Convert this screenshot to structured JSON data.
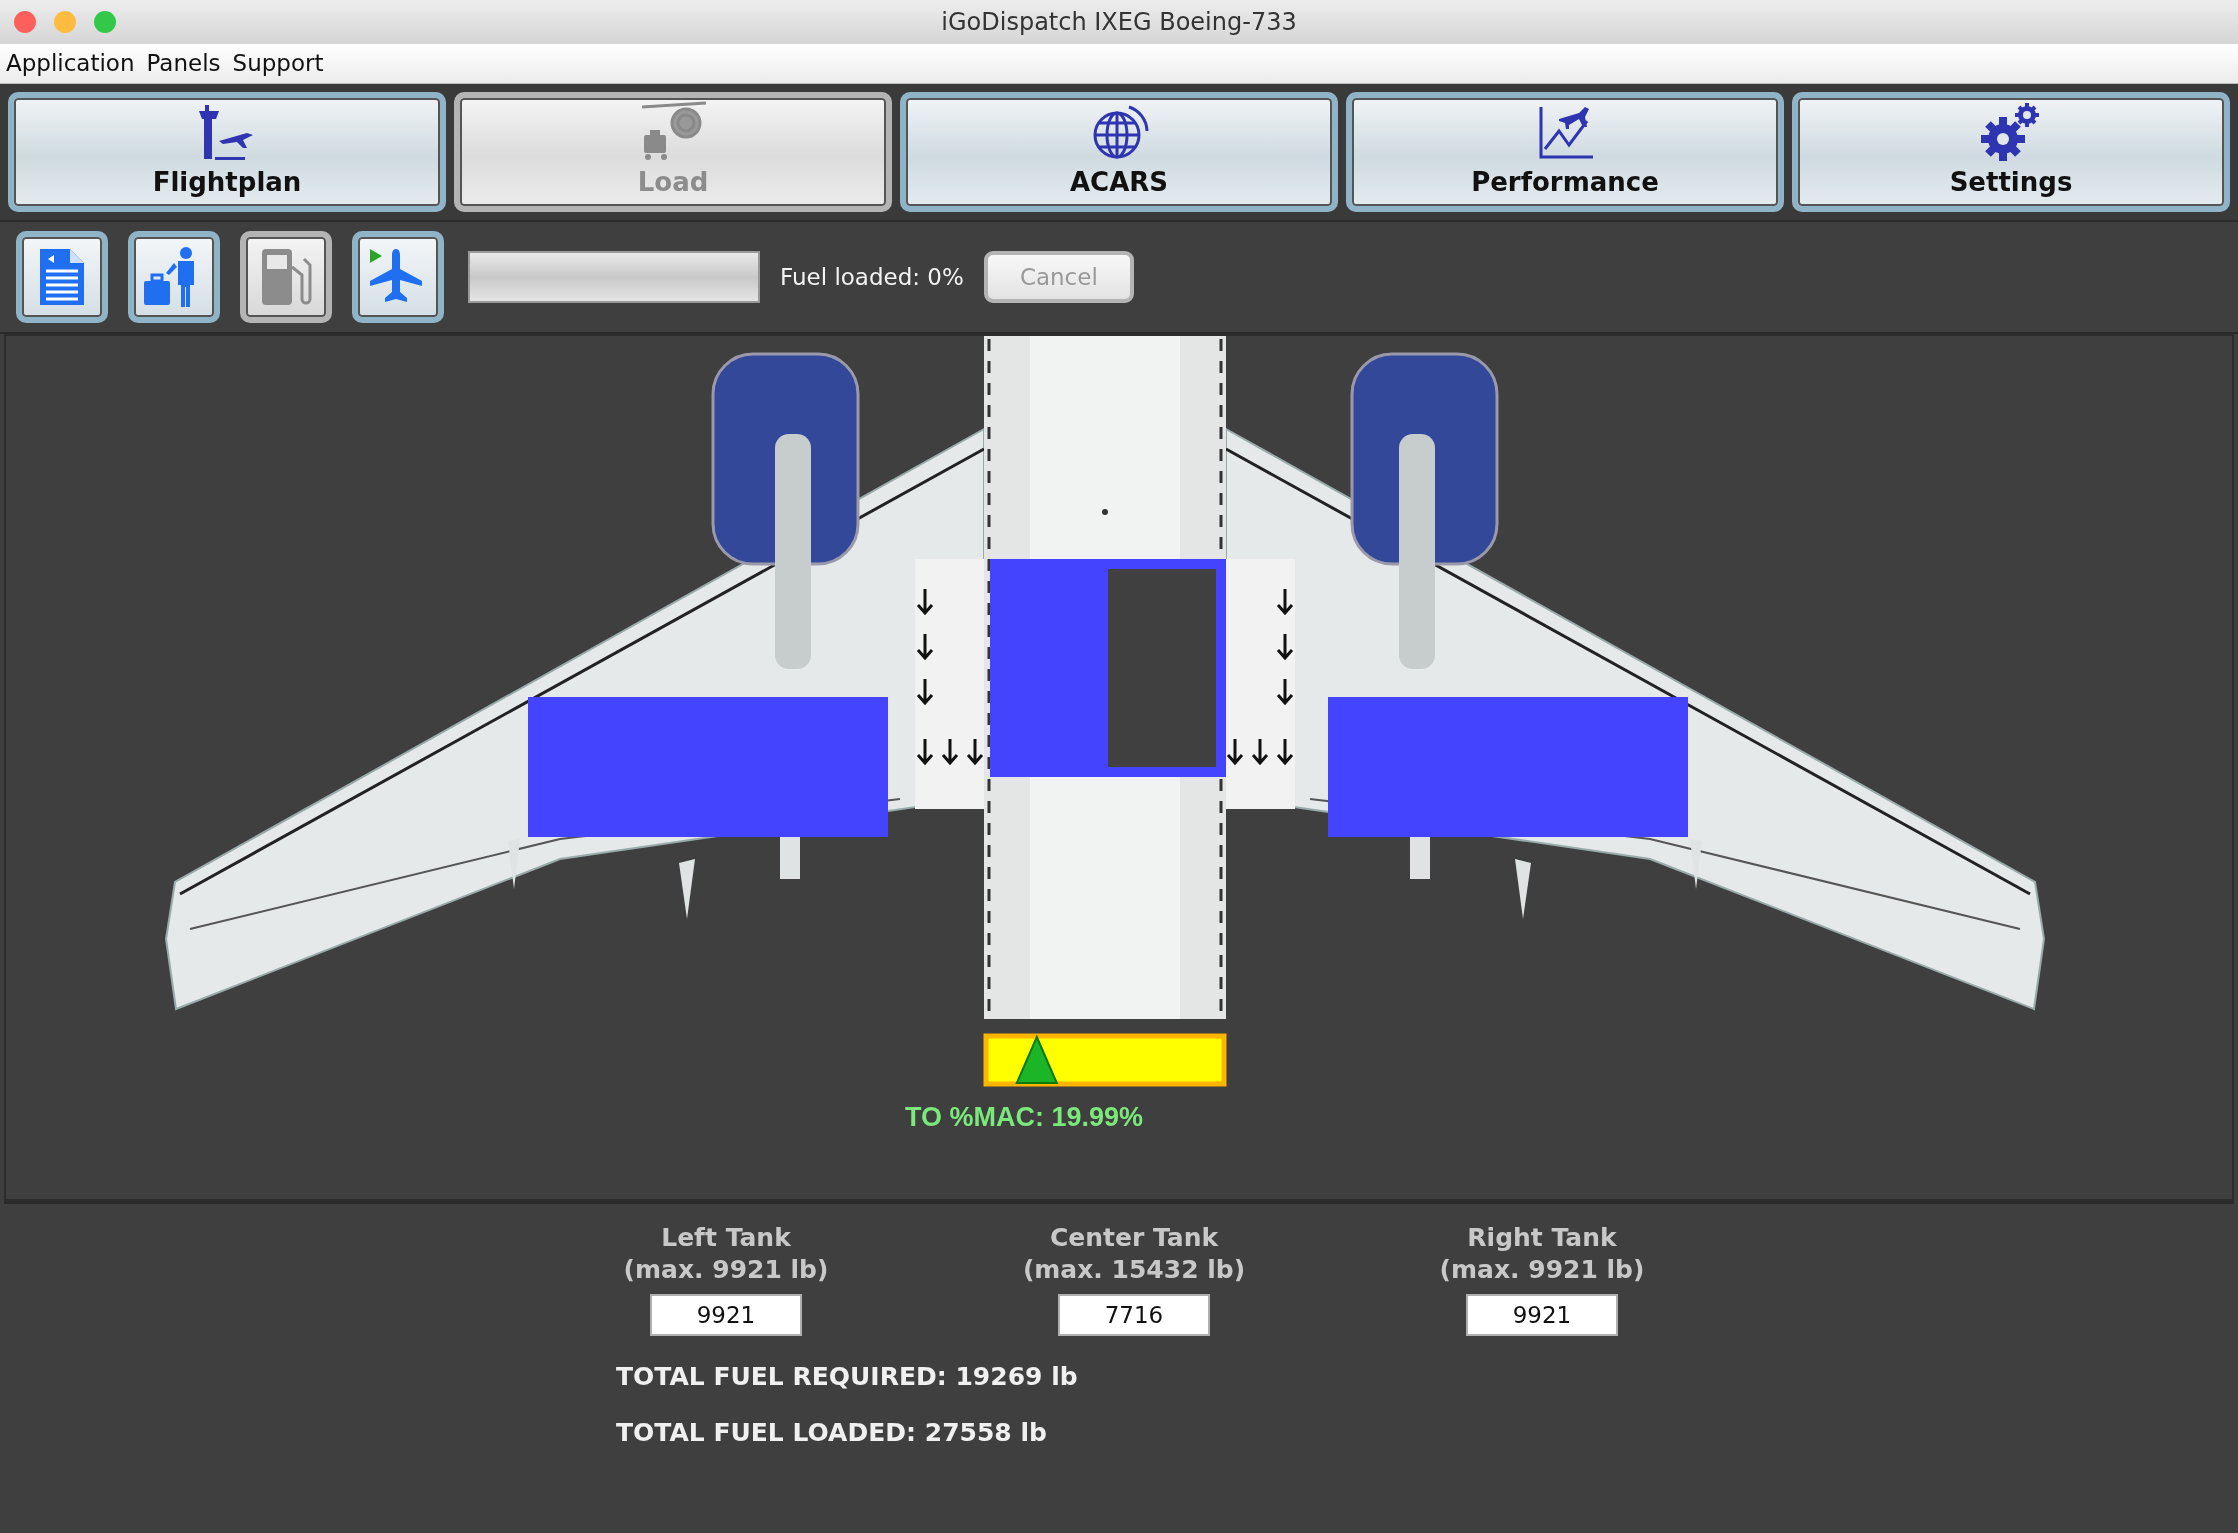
{
  "window": {
    "title": "iGoDispatch IXEG Boeing-733"
  },
  "menu": [
    "Application",
    "Panels",
    "Support"
  ],
  "tabs": [
    {
      "label": "Flightplan",
      "selected": false
    },
    {
      "label": "Load",
      "selected": true
    },
    {
      "label": "ACARS",
      "selected": false
    },
    {
      "label": "Performance",
      "selected": false
    },
    {
      "label": "Settings",
      "selected": false
    }
  ],
  "tool_buttons": [
    {
      "selected": false
    },
    {
      "selected": false
    },
    {
      "selected": true
    },
    {
      "selected": false
    }
  ],
  "progress": {
    "level": 0
  },
  "fuel_loaded": "Fuel loaded: 0%",
  "cancel": {
    "label": "Cancel",
    "disabled": true
  },
  "tanks": [
    {
      "level": 1
    },
    {
      "level": 0.5
    },
    {
      "level": 1
    }
  ],
  "mac": {
    "level": 0.2,
    "label": "TO %MAC: 19.99%"
  },
  "tank_fields": [
    {
      "name": "Left Tank",
      "max": "(max. 9921 lb)",
      "value": "9921"
    },
    {
      "name": "Center Tank",
      "max": "(max. 15432 lb)",
      "value": "7716"
    },
    {
      "name": "Right Tank",
      "max": "(max. 9921 lb)",
      "value": "9921"
    }
  ],
  "totals": [
    "TOTAL FUEL REQUIRED: 19269 lb",
    "TOTAL FUEL LOADED: 27558 lb"
  ]
}
